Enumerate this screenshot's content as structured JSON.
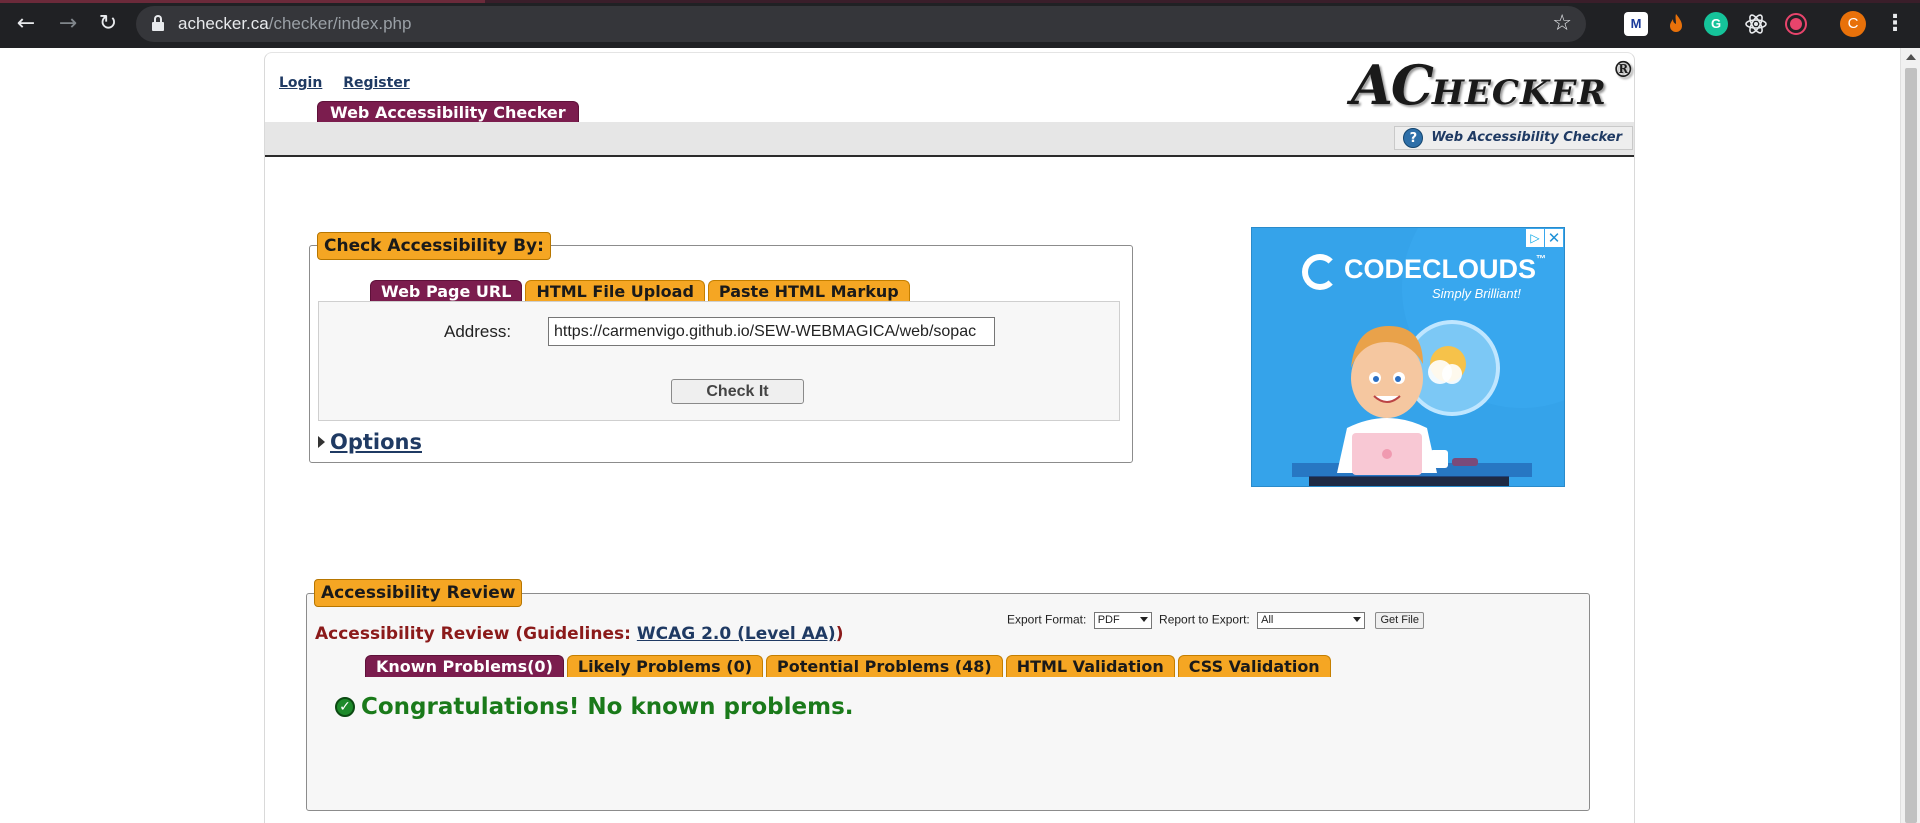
{
  "browser": {
    "url_domain": "achecker.ca",
    "url_path": "/checker/index.php",
    "avatar_letter": "C",
    "extensions": [
      "M",
      "G"
    ]
  },
  "header": {
    "login_label": "Login",
    "register_label": "Register",
    "logo_ac": "AC",
    "logo_hecker": "HECKER",
    "logo_reg": "®",
    "main_tab": "Web Accessibility Checker",
    "help_label": "Web Accessibility Checker"
  },
  "check": {
    "legend": "Check Accessibility By:",
    "tabs": [
      {
        "label": "Web Page URL",
        "active": true
      },
      {
        "label": "HTML File Upload",
        "active": false
      },
      {
        "label": "Paste HTML Markup",
        "active": false
      }
    ],
    "address_label": "Address:",
    "address_value": "https://carmenvigo.github.io/SEW-WEBMAGICA/web/sopac",
    "check_button": "Check It",
    "options_label": "Options"
  },
  "ad": {
    "brand": "CODECLOUDS",
    "tm": "™",
    "tagline": "Simply Brilliant!",
    "close": "✕",
    "adchoices": "▷"
  },
  "review": {
    "legend": "Accessibility Review",
    "title_prefix": "Accessibility Review (Guidelines: ",
    "guideline_link": "WCAG 2.0 (Level AA)",
    "title_suffix": ")",
    "export_format_label": "Export Format:",
    "export_format_value": "PDF",
    "report_label": "Report to Export:",
    "report_value": "All",
    "get_file": "Get File",
    "tabs": [
      {
        "label": "Known Problems(0)",
        "active": true
      },
      {
        "label": "Likely Problems (0)",
        "active": false
      },
      {
        "label": "Potential Problems (48)",
        "active": false
      },
      {
        "label": "HTML Validation",
        "active": false
      },
      {
        "label": "CSS Validation",
        "active": false
      }
    ],
    "message": "Congratulations! No known problems."
  }
}
